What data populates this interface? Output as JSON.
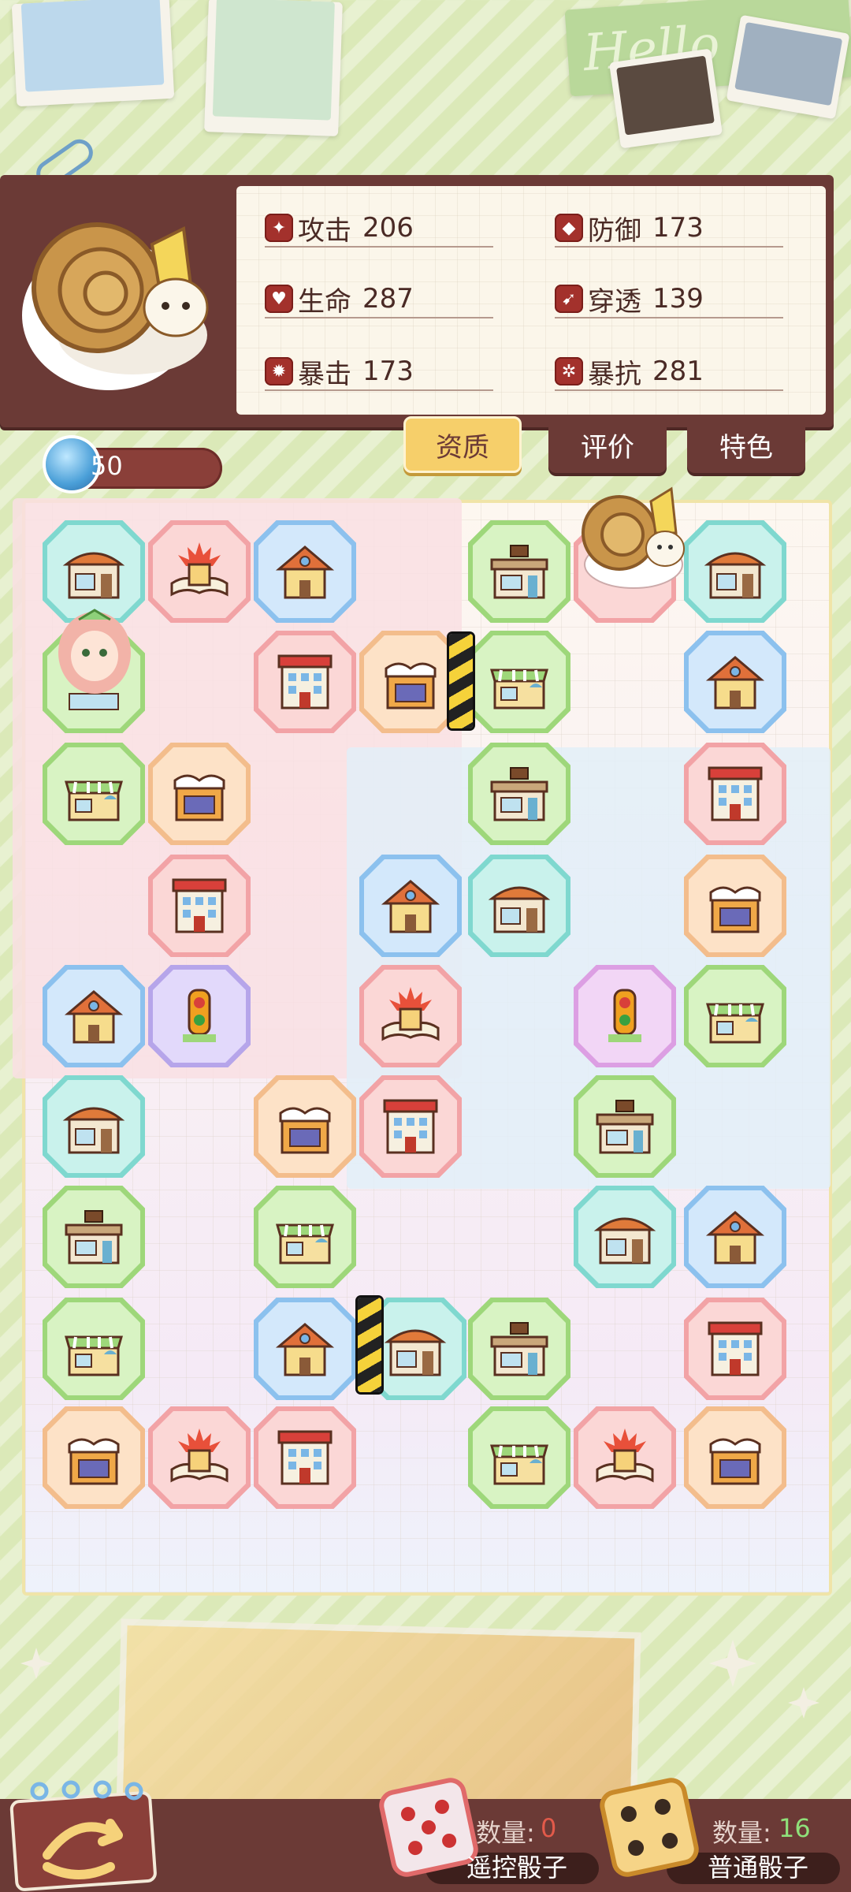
{
  "stats": {
    "attack": {
      "label": "攻击",
      "value": "206"
    },
    "defense": {
      "label": "防御",
      "value": "173"
    },
    "hp": {
      "label": "生命",
      "value": "287"
    },
    "pierce": {
      "label": "穿透",
      "value": "139"
    },
    "crit": {
      "label": "暴击",
      "value": "173"
    },
    "crit_resist": {
      "label": "暴抗",
      "value": "281"
    }
  },
  "tabs": [
    "资质",
    "评价",
    "特色"
  ],
  "active_tab": "资质",
  "energy": "50",
  "decor_text": "Hello",
  "dice": {
    "remote": {
      "count_label": "数量:",
      "count": "0",
      "label": "遥控骰子"
    },
    "normal": {
      "count_label": "数量:",
      "count": "16",
      "label": "普通骰子"
    }
  },
  "colors": {
    "panel": "#6b3a36",
    "active_tab": "#f6cf6a",
    "remote_count": "#e25a4a",
    "normal_count": "#8fe07a"
  }
}
